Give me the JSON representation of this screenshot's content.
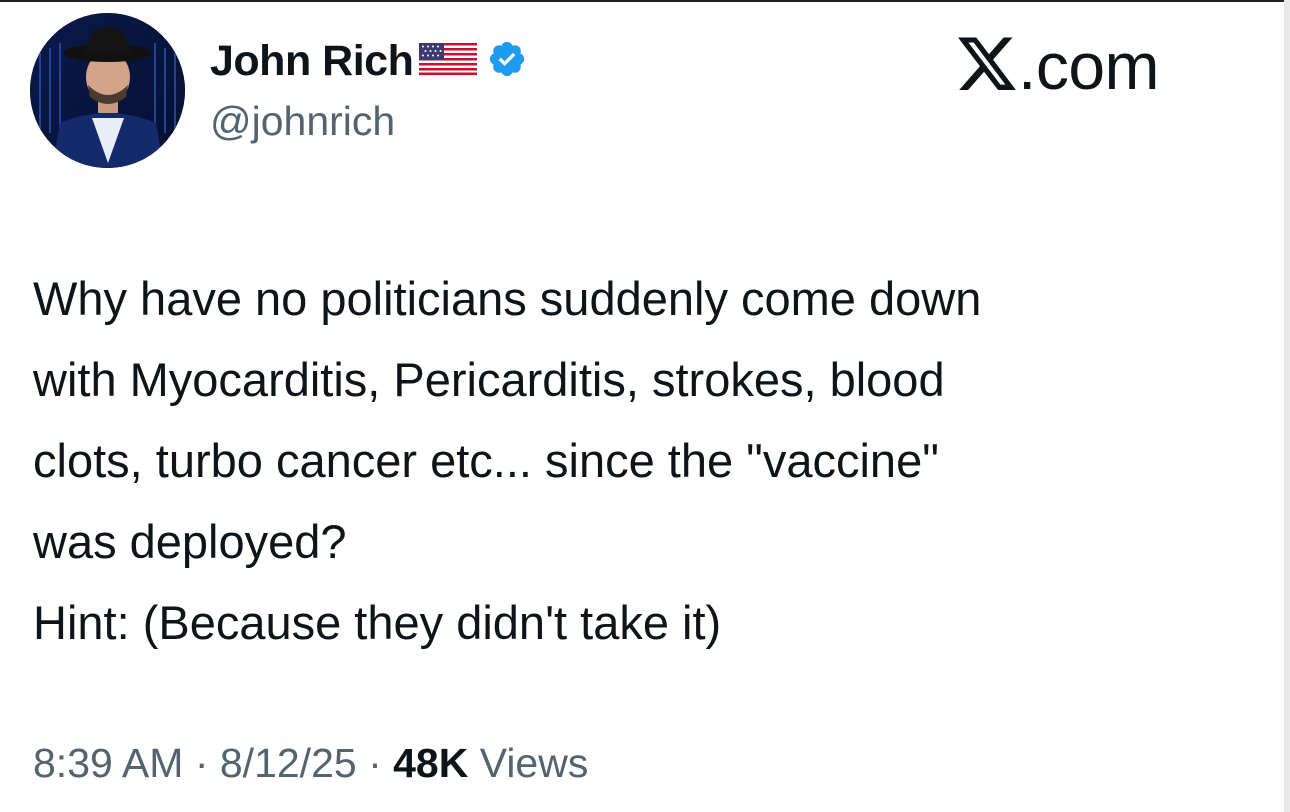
{
  "author": {
    "display_name": "John Rich",
    "handle": "@johnrich",
    "flag_icon": "us-flag-icon",
    "verified_icon": "verified-badge-icon",
    "verified_color": "#1d9bf0"
  },
  "brand": {
    "logo_letter": "X",
    "domain_suffix": ".com"
  },
  "tweet": {
    "lines": [
      "Why have no politicians suddenly come down",
      "with Myocarditis, Pericarditis, strokes, blood",
      "clots, turbo cancer etc... since the \"vaccine\"",
      "was deployed?",
      "Hint: (Because they didn't take it)"
    ]
  },
  "meta": {
    "time": "8:39 AM",
    "separator": " · ",
    "date": "8/12/25",
    "views_count": "48K",
    "views_label": " Views"
  },
  "colors": {
    "text": "#0f1419",
    "secondary": "#536471"
  }
}
